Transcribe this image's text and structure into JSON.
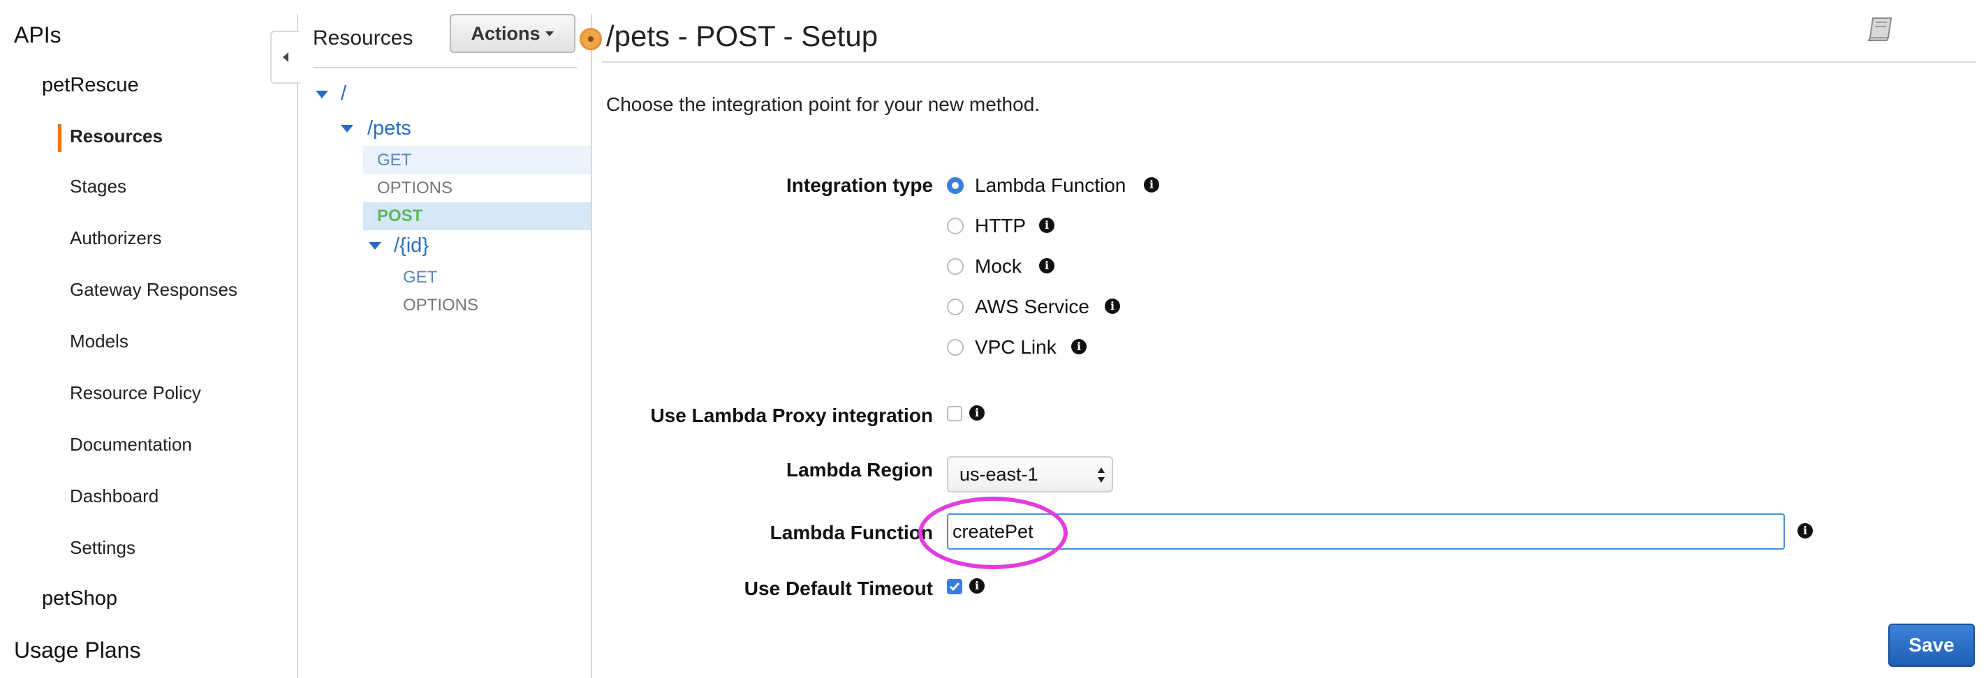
{
  "nav": {
    "apis_label": "APIs",
    "api1": "petRescue",
    "items": [
      "Resources",
      "Stages",
      "Authorizers",
      "Gateway Responses",
      "Models",
      "Resource Policy",
      "Documentation",
      "Dashboard",
      "Settings"
    ],
    "api2": "petShop",
    "usage_plans": "Usage Plans"
  },
  "resources": {
    "title": "Resources",
    "actions_label": "Actions",
    "tree": {
      "root": "/",
      "pets": "/pets",
      "pets_get": "GET",
      "pets_options": "OPTIONS",
      "pets_post": "POST",
      "id": "/{id}",
      "id_get": "GET",
      "id_options": "OPTIONS"
    }
  },
  "main": {
    "title": "/pets - POST - Setup",
    "description": "Choose the integration point for your new method.",
    "integration_type_label": "Integration type",
    "integration_options": [
      "Lambda Function",
      "HTTP",
      "Mock",
      "AWS Service",
      "VPC Link"
    ],
    "selected_integration": "Lambda Function",
    "proxy_label": "Use Lambda Proxy integration",
    "proxy_checked": false,
    "region_label": "Lambda Region",
    "region_value": "us-east-1",
    "function_label": "Lambda Function",
    "function_value": "createPet",
    "timeout_label": "Use Default Timeout",
    "timeout_checked": true,
    "save_label": "Save"
  },
  "colors": {
    "link_blue": "#2a6cbf",
    "post_green": "#5cb85c",
    "active_orange": "#e47911",
    "highlight_blue": "#d6e7f8",
    "annotation_magenta": "#e23ddc",
    "primary_button": "#1e5fb5"
  }
}
